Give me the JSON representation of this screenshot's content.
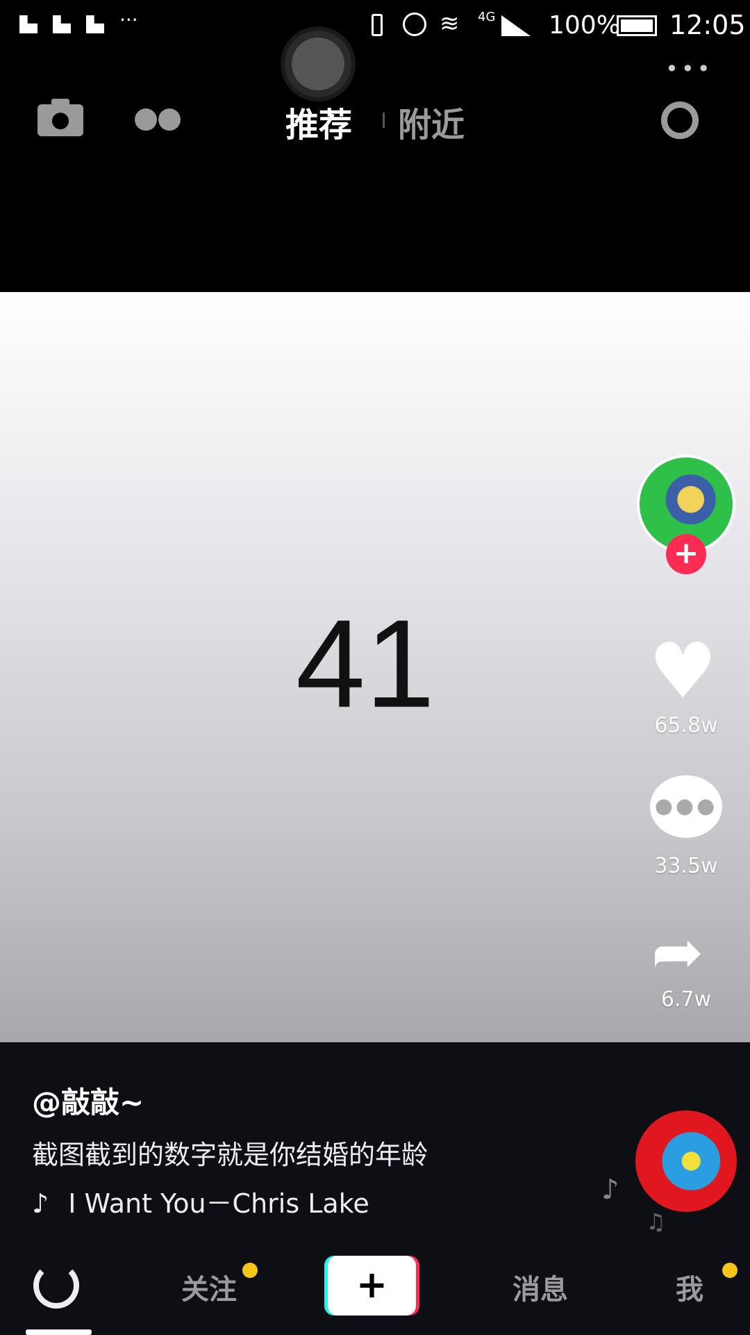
{
  "status_bar": {
    "network": "4G",
    "battery": "100%",
    "time": "12:05"
  },
  "top_nav": {
    "tabs": [
      {
        "label": "推荐",
        "active": true
      },
      {
        "label": "附近",
        "active": false
      }
    ]
  },
  "video": {
    "overlay_text": "41"
  },
  "actions": {
    "likes": "65.8w",
    "comments": "33.5w",
    "shares": "6.7w"
  },
  "post": {
    "username": "@敲敲~",
    "caption": "截图截到的数字就是你结婚的年龄",
    "music": "I Want You－Chris Lake"
  },
  "bottom_nav": {
    "items": [
      {
        "label": "关注"
      },
      {
        "label": "消息"
      },
      {
        "label": "我"
      }
    ],
    "create_label": "+"
  },
  "colors": {
    "accent_red": "#fe2c55",
    "badge_yellow": "#f5c518",
    "bg": "#0e0f15"
  }
}
